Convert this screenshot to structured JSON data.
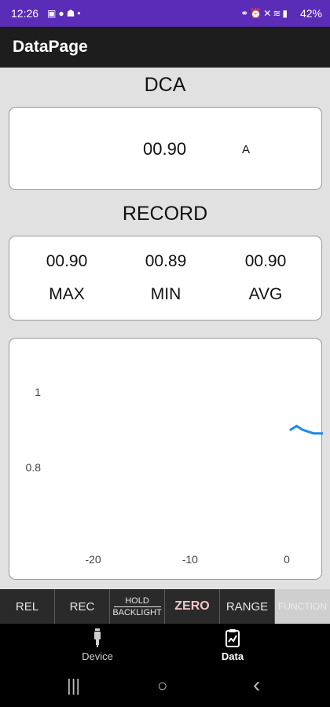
{
  "status_bar": {
    "time": "12:26",
    "battery": "42%",
    "left_icons": [
      "image-icon",
      "facebook-icon",
      "snapchat-icon",
      "dot-icon"
    ],
    "right_icons": [
      "link-icon",
      "alarm-icon",
      "mute-icon",
      "wifi-icon",
      "signal-icon"
    ]
  },
  "app_bar": {
    "title": "DataPage"
  },
  "reading": {
    "mode": "DCA",
    "value": "00.90",
    "unit": "A"
  },
  "record": {
    "title": "RECORD",
    "items": [
      {
        "value": "00.90",
        "label": "MAX"
      },
      {
        "value": "00.89",
        "label": "MIN"
      },
      {
        "value": "00.90",
        "label": "AVG"
      }
    ]
  },
  "chart_data": {
    "type": "line",
    "xlim": [
      -25,
      3
    ],
    "ylim": [
      0.6,
      1.1
    ],
    "xticks": [
      "-20",
      "-10",
      "0"
    ],
    "xtick_values": [
      -20,
      -10,
      0
    ],
    "yticks": [
      "1",
      "0.8"
    ],
    "ytick_values": [
      1,
      0.8
    ],
    "series": [
      {
        "color": "#1e88e5",
        "x": [
          0.4,
          1.0,
          1.6,
          2.2,
          2.8,
          3.4,
          4.0,
          4.6,
          5.2,
          5.8,
          6.4,
          7.0,
          7.6,
          8.2,
          8.8
        ],
        "y": [
          0.9,
          0.91,
          0.9,
          0.895,
          0.89,
          0.89,
          0.89,
          0.89,
          0.89,
          0.895,
          0.9,
          0.9,
          0.895,
          0.9,
          0.9
        ]
      }
    ]
  },
  "function_bar": {
    "buttons": [
      {
        "label": "REL"
      },
      {
        "label": "REC"
      },
      {
        "label_top": "HOLD",
        "label_bottom": "BACKLIGHT"
      },
      {
        "label": "ZERO"
      },
      {
        "label": "RANGE"
      },
      {
        "label": "FUNCTION"
      }
    ]
  },
  "bottom_nav": {
    "items": [
      {
        "label": "Device",
        "icon": "probe-icon"
      },
      {
        "label": "Data",
        "icon": "clipboard-chart-icon"
      }
    ]
  },
  "system_nav": {
    "recents": "|||",
    "home": "○",
    "back": "‹"
  },
  "colors": {
    "status_bar": "#5b2cb8",
    "app_bar": "#1d1d1d",
    "content_bg": "#e1e1e1",
    "series": "#1e88e5",
    "function_disabled": "#cfcfcf"
  }
}
